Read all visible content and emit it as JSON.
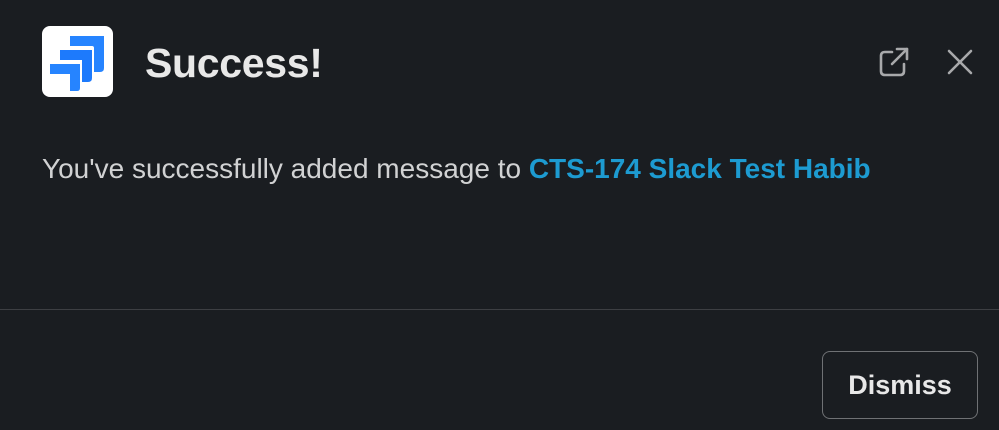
{
  "dialog": {
    "title": "Success!",
    "app_icon": "jira-logo-icon",
    "header_actions": [
      {
        "name": "open-external-icon",
        "icon": "external-link"
      },
      {
        "name": "close-icon",
        "icon": "x"
      }
    ]
  },
  "message": {
    "prefix": "You've successfully added message to ",
    "issue_link": "CTS-174 Slack Test Habib"
  },
  "footer": {
    "dismiss_label": "Dismiss"
  },
  "colors": {
    "background": "#1a1d21",
    "text": "#d1d2d3",
    "title": "#e8e8e8",
    "link": "#1d9bd1",
    "divider": "#3d3f43",
    "logo_blue": "#2684ff"
  }
}
